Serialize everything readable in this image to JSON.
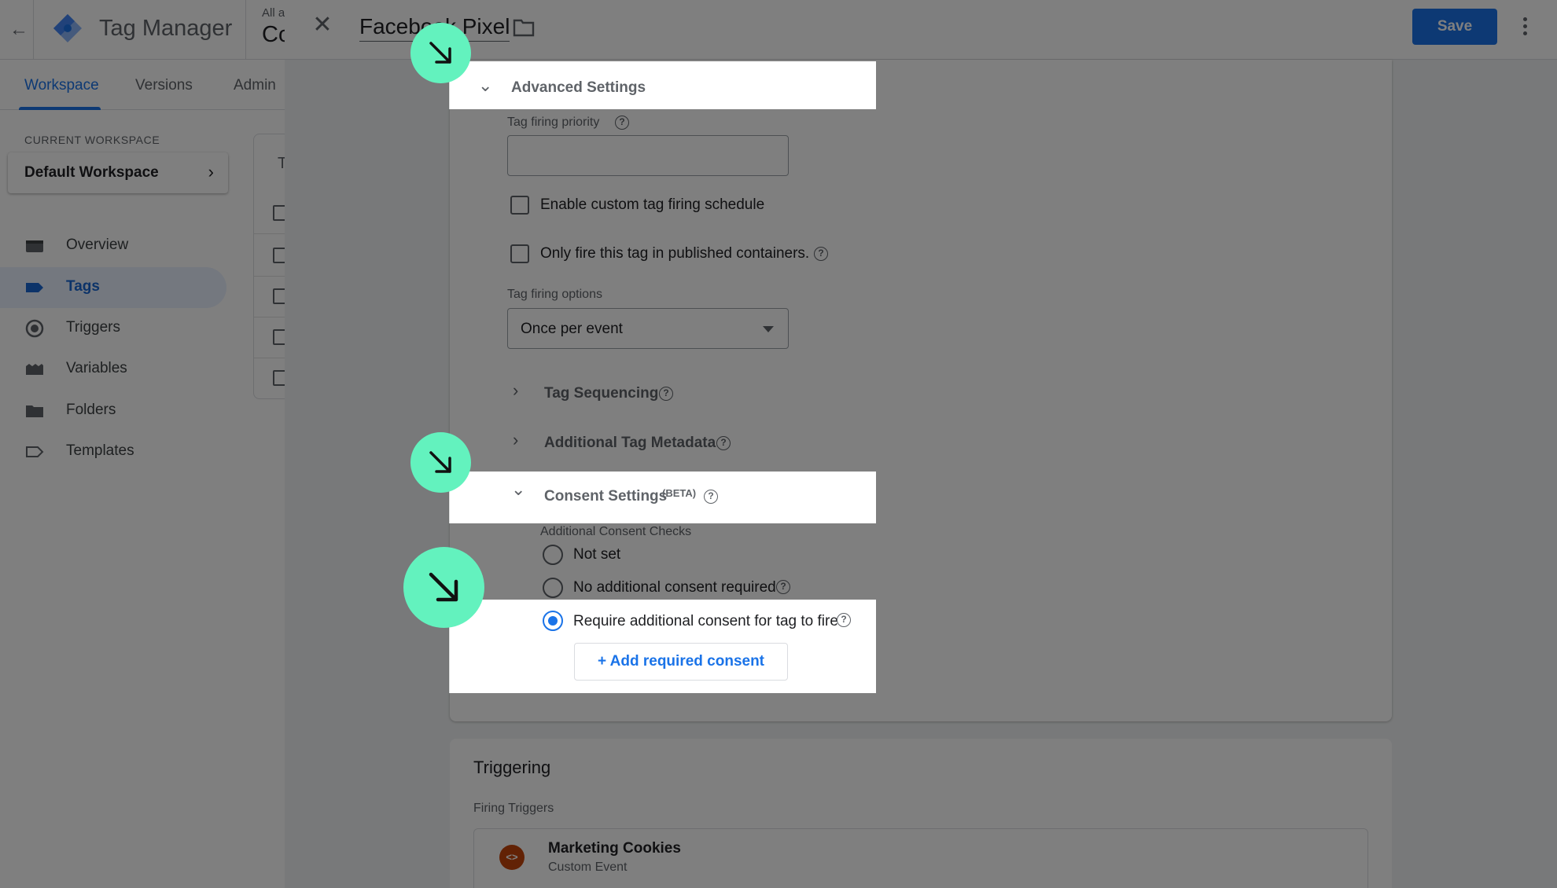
{
  "app": {
    "name": "Tag Manager",
    "account_line": "All a",
    "container_line": "Co",
    "tabs": [
      "Workspace",
      "Versions",
      "Admin"
    ],
    "workspace": {
      "label": "CURRENT WORKSPACE",
      "name": "Default Workspace"
    },
    "nav": [
      "Overview",
      "Tags",
      "Triggers",
      "Variables",
      "Folders",
      "Templates"
    ],
    "tags_card_title": "T"
  },
  "panel": {
    "tag_name": "Facebook Pixel",
    "save_label": "Save",
    "advanced": {
      "title": "Advanced Settings",
      "priority_label": "Tag firing priority",
      "priority_value": "",
      "schedule_label": "Enable custom tag firing schedule",
      "published_only_label": "Only fire this tag in published containers.",
      "firing_options_label": "Tag firing options",
      "firing_options_value": "Once per event",
      "sequencing_title": "Tag Sequencing",
      "metadata_title": "Additional Tag Metadata"
    },
    "consent": {
      "title": "Consent Settings",
      "beta": "(BETA)",
      "checks_label": "Additional Consent Checks",
      "options": [
        "Not set",
        "No additional consent required",
        "Require additional consent for tag to fire"
      ],
      "selected_index": 2,
      "add_button": "+ Add required consent"
    },
    "triggering": {
      "title": "Triggering",
      "firing_label": "Firing Triggers",
      "trigger_name": "Marketing Cookies",
      "trigger_type": "Custom Event",
      "trigger_icon_glyph": "<>"
    }
  },
  "colors": {
    "accent": "#1a73e8",
    "callout": "#63f2be",
    "trigger_icon": "#c5450b",
    "scrim": "rgba(0,0,0,0.5)"
  }
}
